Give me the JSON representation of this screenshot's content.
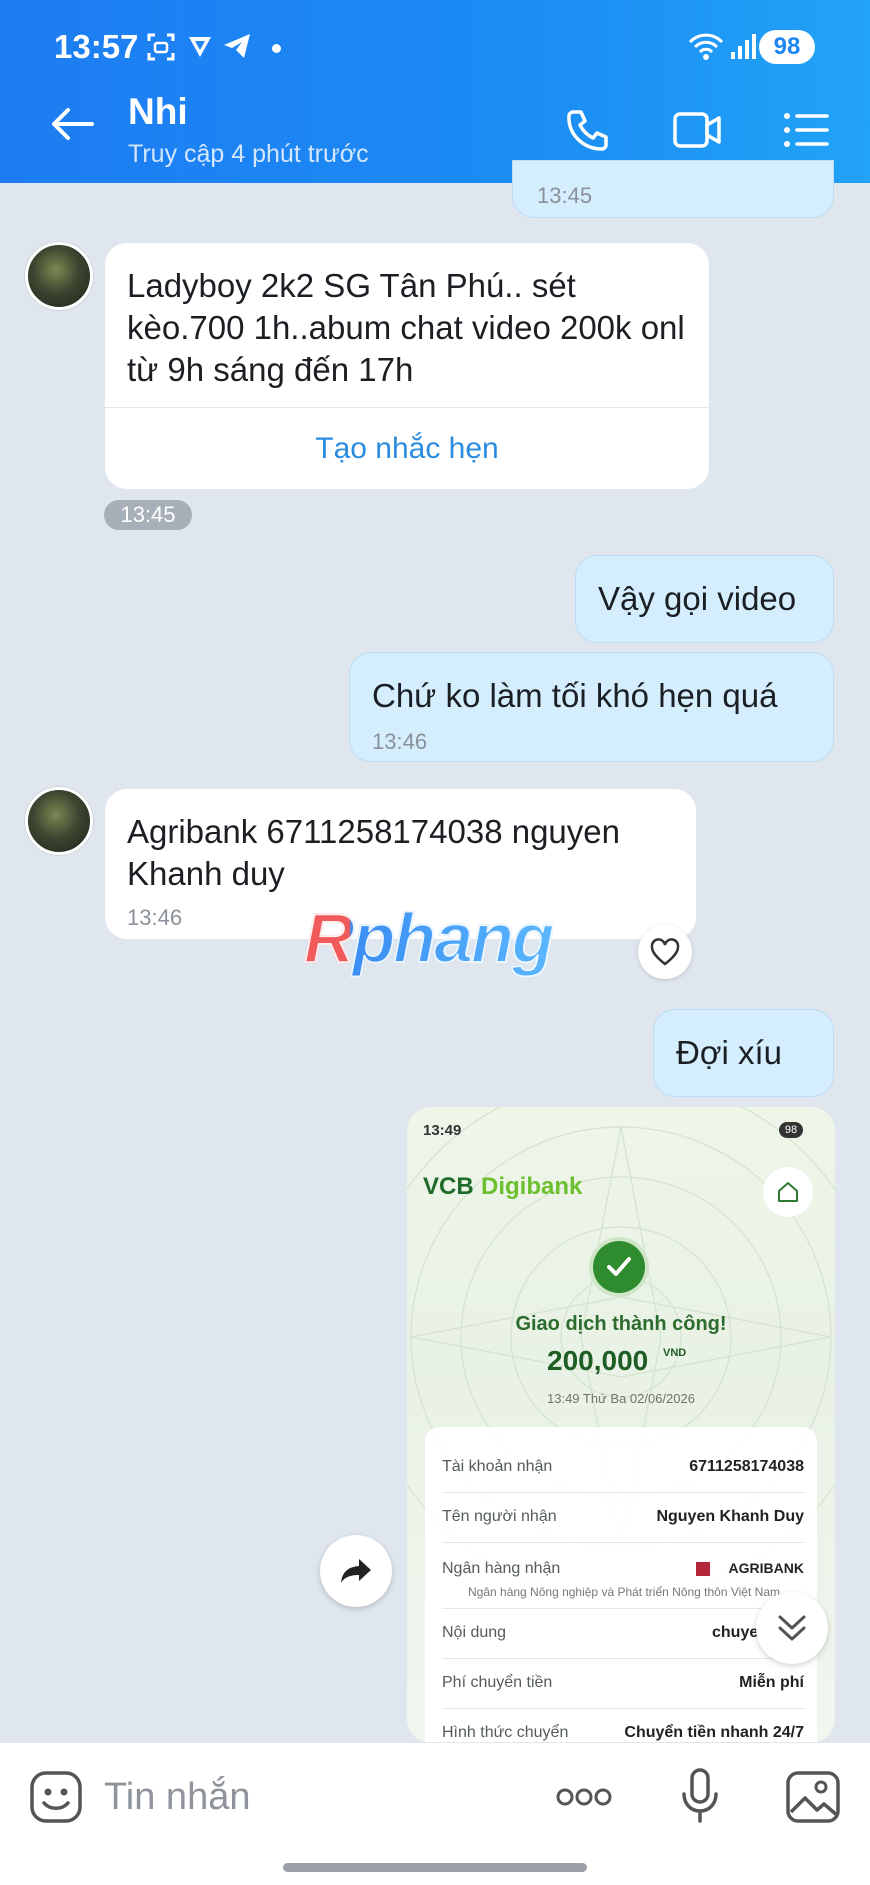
{
  "status_bar": {
    "time": "13:57",
    "battery": "98"
  },
  "header": {
    "title": "Nhi",
    "subtitle": "Truy cập 4 phút trước"
  },
  "messages": {
    "prev_time": "13:45",
    "m1": {
      "text": "Ladyboy 2k2 SG Tân Phú.. sét kèo.700 1h..abum chat video 200k onl từ 9h sáng đến 17h",
      "action": "Tạo nhắc hẹn",
      "time": "13:45"
    },
    "m2": {
      "text": "Vậy gọi video"
    },
    "m3": {
      "text": "Chứ ko làm tối khó hẹn quá",
      "time": "13:46"
    },
    "m4": {
      "text": "Agribank 6711258174038 nguyen Khanh duy",
      "time": "13:46"
    },
    "m5": {
      "text": "Đợi xíu"
    }
  },
  "watermark": "Rphang",
  "receipt": {
    "status_time": "13:49",
    "status_battery": "98",
    "brand_vcb": "VCB",
    "brand_digibank": "Digibank",
    "success_text": "Giao dịch thành công!",
    "amount": "200,000",
    "currency": "VND",
    "datetime": "13:49 Thứ Ba 02/06/2026",
    "rows": [
      {
        "label": "Tài khoản nhận",
        "value": "6711258174038"
      },
      {
        "label": "Tên người nhận",
        "value": "Nguyen Khanh Duy"
      },
      {
        "label": "Ngân hàng nhận",
        "value": "AGRIBANK",
        "sub": "Ngân hàng Nông nghiệp và Phát triển Nông thôn Việt Nam"
      },
      {
        "label": "Nội dung",
        "value": "chuye"
      },
      {
        "label": "Phí chuyển tiền",
        "value": "Miễn phí"
      },
      {
        "label": "Hình thức chuyển",
        "value": "Chuyển tiền nhanh 24/7"
      }
    ]
  },
  "composer": {
    "placeholder": "Tin nhắn"
  },
  "colors": {
    "header_blue": "#1d7cf2",
    "bubble_out": "#d5eefe",
    "chat_bg": "#dfe6ee",
    "link_blue": "#2a8ce0",
    "vcb_green": "#2e7d32"
  }
}
